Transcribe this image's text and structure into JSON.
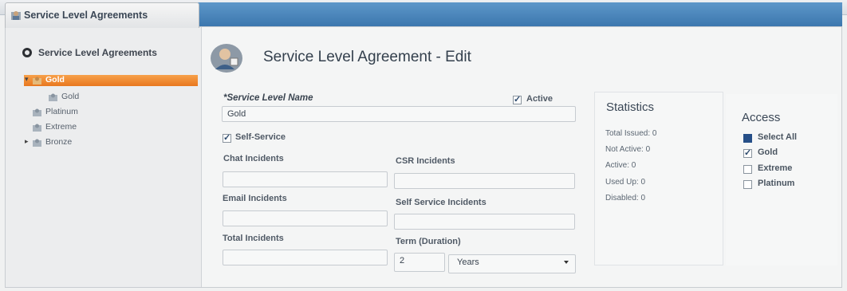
{
  "tab": {
    "title": "Service Level Agreements"
  },
  "sidebar": {
    "header": "Service Level Agreements",
    "items": [
      {
        "label": "Gold",
        "selected": true,
        "expanded": true
      },
      {
        "label": "Gold",
        "child": true
      },
      {
        "label": "Platinum"
      },
      {
        "label": "Extreme"
      },
      {
        "label": "Bronze",
        "collapsed": true
      }
    ]
  },
  "page": {
    "title": "Service Level Agreement - Edit"
  },
  "form": {
    "name_label": "*Service Level Name",
    "name_value": "Gold",
    "active_label": "Active",
    "active_checked": true,
    "self_service_label": "Self-Service",
    "self_service_checked": true,
    "chat_label": "Chat Incidents",
    "chat_value": "",
    "csr_label": "CSR Incidents",
    "csr_value": "",
    "email_label": "Email Incidents",
    "email_value": "",
    "self_service_incidents_label": "Self Service Incidents",
    "self_service_incidents_value": "",
    "total_label": "Total Incidents",
    "total_value": "",
    "term_label": "Term (Duration)",
    "term_value": "2",
    "term_unit": "Years"
  },
  "statistics": {
    "title": "Statistics",
    "total_issued": "Total Issued: 0",
    "not_active": "Not Active: 0",
    "active": "Active: 0",
    "used_up": "Used Up: 0",
    "disabled": "Disabled: 0"
  },
  "access": {
    "title": "Access",
    "select_all": "Select All",
    "items": [
      {
        "label": "Gold",
        "checked": true
      },
      {
        "label": "Extreme",
        "checked": false
      },
      {
        "label": "Platinum",
        "checked": false
      }
    ]
  },
  "colors": {
    "accent_orange": "#ee8427",
    "header_blue": "#4a86bd"
  }
}
